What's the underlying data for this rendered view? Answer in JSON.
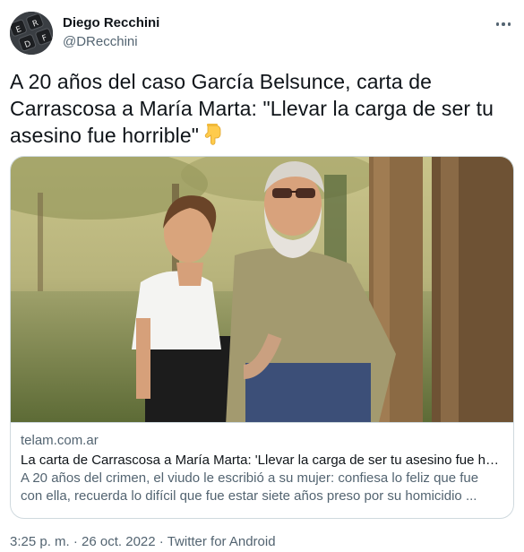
{
  "author": {
    "display_name": "Diego Recchini",
    "handle": "@DRecchini",
    "avatar_letters": [
      "E",
      "R",
      "D",
      "F"
    ]
  },
  "more_icon": "more-horizontal-icon",
  "tweet": {
    "text": "A 20 años del caso García Belsunce, carta de Carrascosa a María Marta: \"Llevar la carga de ser tu asesino fue horrible\"",
    "emoji": "backhand-index-pointing-down"
  },
  "card": {
    "domain": "telam.com.ar",
    "title": "La carta de Carrascosa a María Marta: 'Llevar la carga de ser tu asesino fue horrible'",
    "description": "A 20 años del crimen, el viudo le escribió a su mujer: confiesa lo feliz que fue con ella, recuerda lo difícil que fue estar siete años preso por su homicidio ..."
  },
  "meta": {
    "time": "3:25 p. m.",
    "separator": " · ",
    "date": "26 oct. 2022",
    "source": "Twitter for Android"
  },
  "colors": {
    "text_primary": "#0f1419",
    "text_secondary": "#536471",
    "border": "#cfd9de"
  }
}
